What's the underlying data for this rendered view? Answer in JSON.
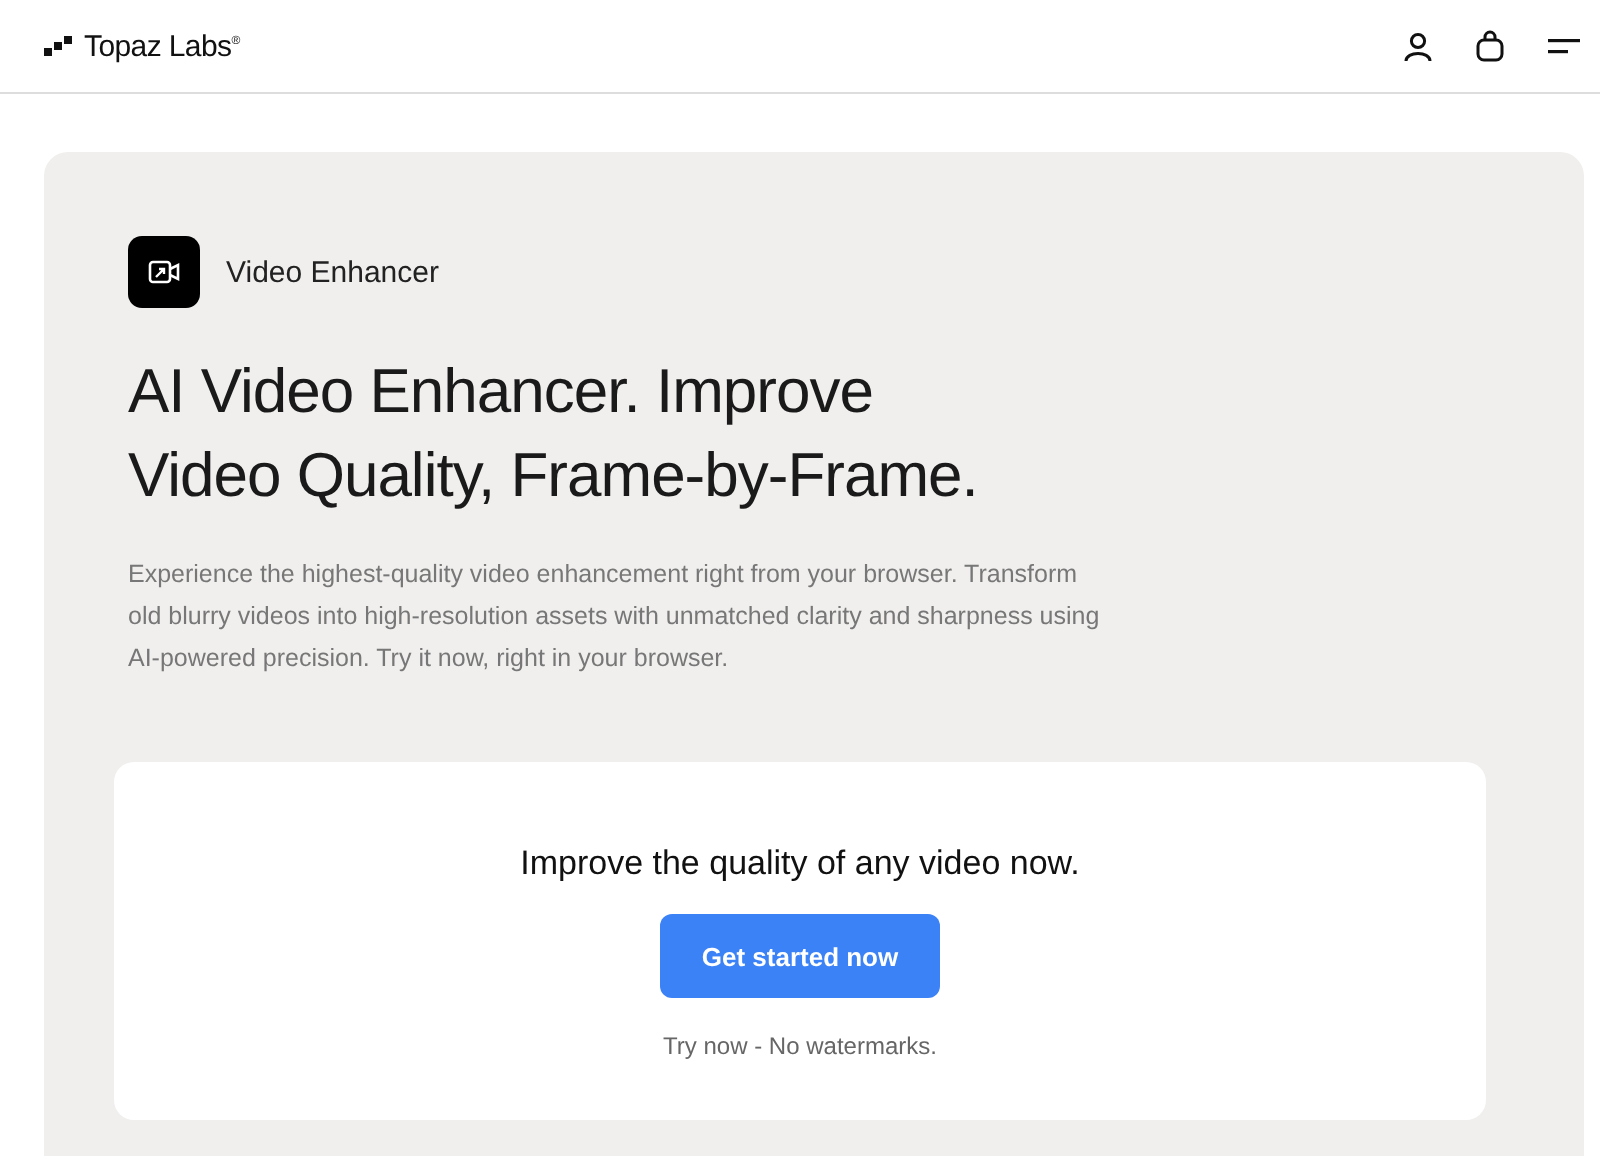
{
  "header": {
    "logo": "Topaz Labs$^{®}$"
  },
  "product": {
    "name": "Video Enhancer"
  },
  "hero": {
    "title": "AI Video Enhancer. Improve Video Quality, Frame-by-Frame.",
    "description": "Experience the highest-quality video enhancement right from your browser. Transform old blurry videos into high-resolution assets with unmatched clarity and sharpness using AI-powered precision. Try it now, right in your browser."
  },
  "cta_card": {
    "heading": "Improve the quality of any video now.",
    "button": "Get started now",
    "note": "Try now - No watermarks."
  }
}
